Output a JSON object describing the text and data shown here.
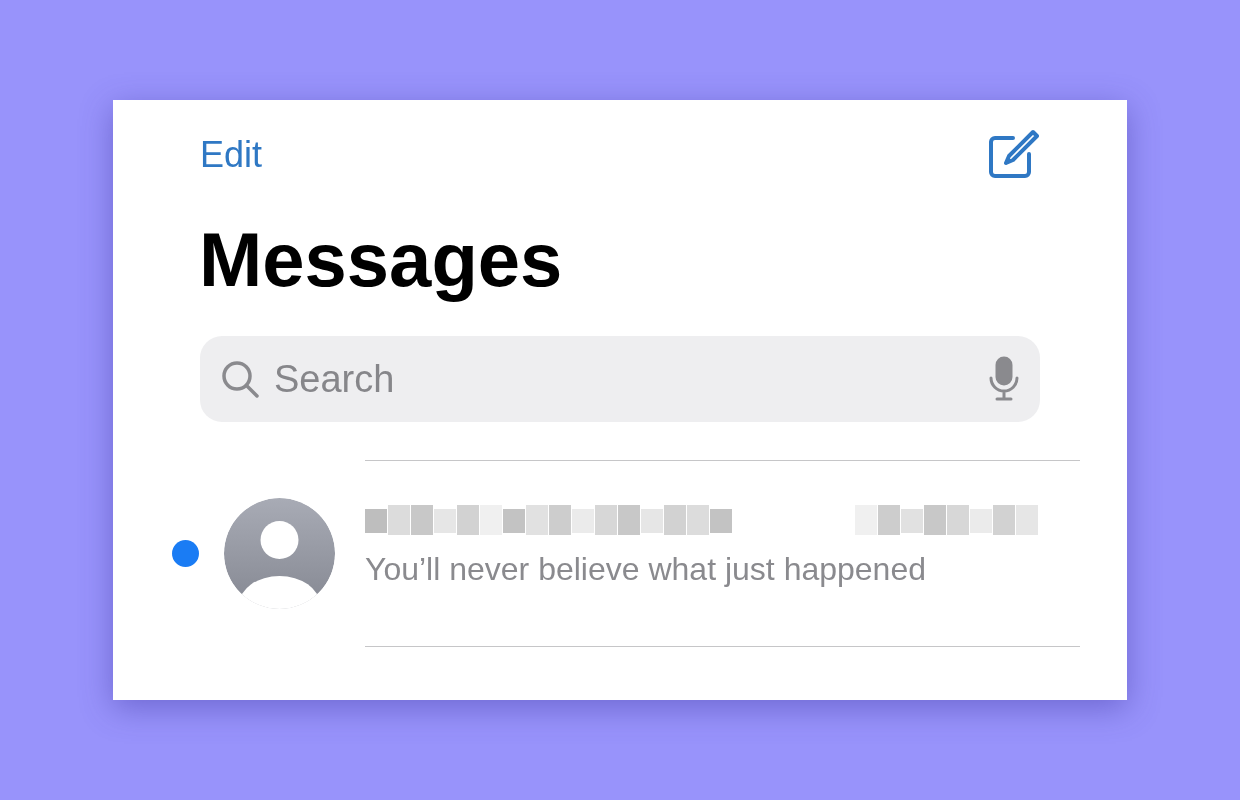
{
  "nav": {
    "edit": "Edit"
  },
  "title": "Messages",
  "search": {
    "placeholder": "Search"
  },
  "conversations": [
    {
      "preview": "You’ll never believe what just happened",
      "unread": true
    }
  ]
}
